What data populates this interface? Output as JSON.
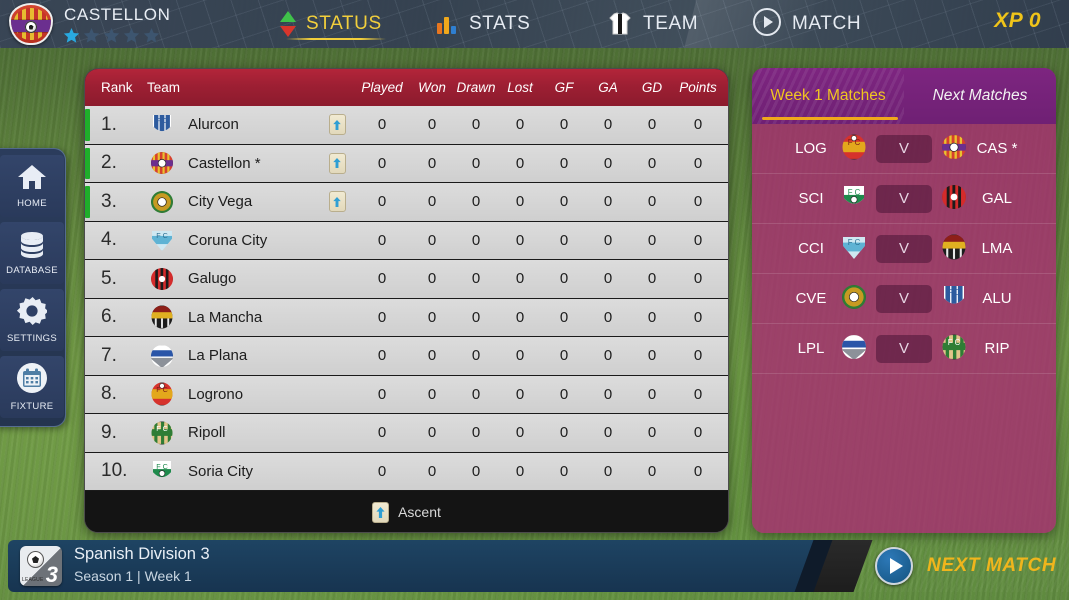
{
  "header": {
    "club_name": "CASTELLON",
    "club_badge_icon": "club-crest-icon",
    "stars_total": 5,
    "stars_filled": 1,
    "star_on_color": "#29a9e0",
    "star_off_color": "#3d556f",
    "xp_label": "XP 0",
    "nav": [
      {
        "label": "STATUS",
        "icon": "status-arrows-icon",
        "active": true
      },
      {
        "label": "STATS",
        "icon": "bar-chart-icon",
        "active": false
      },
      {
        "label": "TEAM",
        "icon": "shirt-icon",
        "active": false
      },
      {
        "label": "MATCH",
        "icon": "play-circle-icon",
        "active": false
      }
    ],
    "active_accent": "#f2cf3c"
  },
  "sidebar": {
    "items": [
      {
        "label": "HOME",
        "icon": "home-icon"
      },
      {
        "label": "DATABASE",
        "icon": "database-icon"
      },
      {
        "label": "SETTINGS",
        "icon": "gear-icon"
      },
      {
        "label": "FIXTURE",
        "icon": "calendar-icon"
      }
    ]
  },
  "league_table": {
    "columns": {
      "rank": "Rank",
      "team": "Team",
      "played": "Played",
      "won": "Won",
      "drawn": "Drawn",
      "lost": "Lost",
      "gf": "GF",
      "ga": "GA",
      "gd": "GD",
      "points": "Points"
    },
    "header_color": "#9d1f33",
    "promotion_bar_color": "#1fae2a",
    "rows": [
      {
        "rank": "1.",
        "team": "Alurcon",
        "badge": "alurcon-crest-icon",
        "ascent": true,
        "played": "0",
        "won": "0",
        "drawn": "0",
        "lost": "0",
        "gf": "0",
        "ga": "0",
        "gd": "0",
        "points": "0"
      },
      {
        "rank": "2.",
        "team": "Castellon *",
        "badge": "castellon-crest-icon",
        "ascent": true,
        "played": "0",
        "won": "0",
        "drawn": "0",
        "lost": "0",
        "gf": "0",
        "ga": "0",
        "gd": "0",
        "points": "0"
      },
      {
        "rank": "3.",
        "team": "City Vega",
        "badge": "cityvega-crest-icon",
        "ascent": true,
        "played": "0",
        "won": "0",
        "drawn": "0",
        "lost": "0",
        "gf": "0",
        "ga": "0",
        "gd": "0",
        "points": "0"
      },
      {
        "rank": "4.",
        "team": "Coruna City",
        "badge": "corunacity-crest-icon",
        "ascent": false,
        "played": "0",
        "won": "0",
        "drawn": "0",
        "lost": "0",
        "gf": "0",
        "ga": "0",
        "gd": "0",
        "points": "0"
      },
      {
        "rank": "5.",
        "team": "Galugo",
        "badge": "galugo-crest-icon",
        "ascent": false,
        "played": "0",
        "won": "0",
        "drawn": "0",
        "lost": "0",
        "gf": "0",
        "ga": "0",
        "gd": "0",
        "points": "0"
      },
      {
        "rank": "6.",
        "team": "La Mancha",
        "badge": "lamancha-crest-icon",
        "ascent": false,
        "played": "0",
        "won": "0",
        "drawn": "0",
        "lost": "0",
        "gf": "0",
        "ga": "0",
        "gd": "0",
        "points": "0"
      },
      {
        "rank": "7.",
        "team": "La Plana",
        "badge": "laplana-crest-icon",
        "ascent": false,
        "played": "0",
        "won": "0",
        "drawn": "0",
        "lost": "0",
        "gf": "0",
        "ga": "0",
        "gd": "0",
        "points": "0"
      },
      {
        "rank": "8.",
        "team": "Logrono",
        "badge": "logrono-crest-icon",
        "ascent": false,
        "played": "0",
        "won": "0",
        "drawn": "0",
        "lost": "0",
        "gf": "0",
        "ga": "0",
        "gd": "0",
        "points": "0"
      },
      {
        "rank": "9.",
        "team": "Ripoll",
        "badge": "ripoll-crest-icon",
        "ascent": false,
        "played": "0",
        "won": "0",
        "drawn": "0",
        "lost": "0",
        "gf": "0",
        "ga": "0",
        "gd": "0",
        "points": "0"
      },
      {
        "rank": "10.",
        "team": "Soria City",
        "badge": "soriacity-crest-icon",
        "ascent": false,
        "played": "0",
        "won": "0",
        "drawn": "0",
        "lost": "0",
        "gf": "0",
        "ga": "0",
        "gd": "0",
        "points": "0"
      }
    ],
    "legend_label": "Ascent",
    "legend_icon": "ascent-arrow-icon"
  },
  "matches_panel": {
    "tabs": [
      {
        "label": "Week 1 Matches",
        "active": true
      },
      {
        "label": "Next Matches",
        "active": false
      }
    ],
    "vs_label": "V",
    "rows": [
      {
        "home": "LOG",
        "home_badge": "logrono-crest-icon",
        "away": "CAS *",
        "away_badge": "castellon-crest-icon"
      },
      {
        "home": "SCI",
        "home_badge": "soriacity-crest-icon",
        "away": "GAL",
        "away_badge": "galugo-crest-icon"
      },
      {
        "home": "CCI",
        "home_badge": "corunacity-crest-icon",
        "away": "LMA",
        "away_badge": "lamancha-crest-icon"
      },
      {
        "home": "CVE",
        "home_badge": "cityvega-crest-icon",
        "away": "ALU",
        "away_badge": "alurcon-crest-icon"
      },
      {
        "home": "LPL",
        "home_badge": "laplana-crest-icon",
        "away": "RIP",
        "away_badge": "ripoll-crest-icon"
      }
    ]
  },
  "footer": {
    "division": "Spanish Division 3",
    "season_week": "Season 1  |  Week 1",
    "league_badge_text": "LEAGUE",
    "league_badge_number": "3",
    "next_match_label": "NEXT MATCH",
    "next_match_icon": "play-circle-icon"
  }
}
